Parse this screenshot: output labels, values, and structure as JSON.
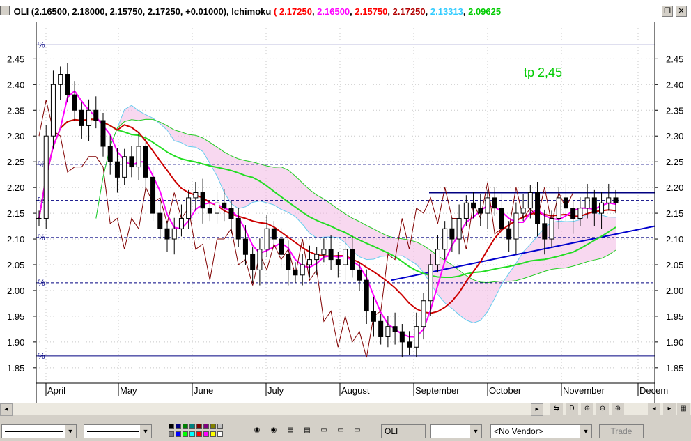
{
  "title_bar": {
    "symbol": "OLI",
    "ohlc_text": "(2.16500, 2.18000, 2.15750, 2.17250, +0.01000),",
    "indicator_name": "Ichimoku",
    "ichimoku_values": [
      {
        "text": "2.17250",
        "color": "#ff0000"
      },
      {
        "text": "2.16500",
        "color": "#ff00ff"
      },
      {
        "text": "2.15750",
        "color": "#ff0000"
      },
      {
        "text": "2.17250",
        "color": "#b00000"
      },
      {
        "text": "2.13313",
        "color": "#33ccff"
      },
      {
        "text": "2.09625",
        "color": "#00cc00"
      }
    ],
    "restore_icon": "restore-window-icon",
    "close_icon": "close-icon",
    "restore_glyph": "❐",
    "close_glyph": "✕"
  },
  "annotation": {
    "text": "tp 2,45",
    "color": "#00cc00"
  },
  "pct_marker": "%",
  "chart_data": {
    "type": "candlestick",
    "y_ticks": [
      "2.45",
      "2.40",
      "2.35",
      "2.30",
      "2.25",
      "2.20",
      "2.15",
      "2.10",
      "2.05",
      "2.00",
      "1.95",
      "1.90",
      "1.85"
    ],
    "ylim": [
      1.82,
      2.51
    ],
    "x_labels": [
      "April",
      "May",
      "June",
      "July",
      "August",
      "September",
      "October",
      "November",
      "Decem"
    ],
    "horizontal_levels": [
      {
        "value": 2.477,
        "style": "solid",
        "color": "#000080"
      },
      {
        "value": 2.245,
        "style": "dashed",
        "color": "#000080"
      },
      {
        "value": 2.175,
        "style": "dashed",
        "color": "#000080"
      },
      {
        "value": 2.103,
        "style": "dashed",
        "color": "#000080"
      },
      {
        "value": 2.015,
        "style": "dashed",
        "color": "#000080"
      },
      {
        "value": 1.873,
        "style": "solid",
        "color": "#000080"
      }
    ],
    "resistance_line": {
      "from_x": "September",
      "to_x": "November",
      "value": 2.19,
      "color": "#000080"
    },
    "trend_line": {
      "from_value": 2.02,
      "to_value": 2.12,
      "color": "#0000cc"
    },
    "series_colors": {
      "tenkan": "#ff00ff",
      "kijun": "#cc0000",
      "chikou": "#800000",
      "senkou_a": "#66ccee",
      "senkou_b": "#22cc22",
      "ma": "#22dd22",
      "candle": "#000000"
    },
    "close_approx": [
      2.14,
      2.3,
      2.4,
      2.42,
      2.38,
      2.35,
      2.32,
      2.35,
      2.33,
      2.28,
      2.25,
      2.22,
      2.26,
      2.24,
      2.28,
      2.22,
      2.15,
      2.12,
      2.1,
      2.12,
      2.14,
      2.18,
      2.19,
      2.16,
      2.15,
      2.17,
      2.16,
      2.14,
      2.1,
      2.07,
      2.04,
      2.08,
      2.12,
      2.1,
      2.07,
      2.04,
      2.03,
      2.05,
      2.06,
      2.07,
      2.08,
      2.06,
      2.05,
      2.08,
      2.04,
      2.02,
      1.96,
      1.94,
      1.91,
      1.93,
      1.92,
      1.9,
      1.89,
      1.93,
      1.98,
      2.05,
      2.08,
      2.12,
      2.1,
      2.14,
      2.17,
      2.16,
      2.15,
      2.18,
      2.16,
      2.12,
      2.1,
      2.15,
      2.16,
      2.19,
      2.13,
      2.1,
      2.14,
      2.18,
      2.16,
      2.14,
      2.16,
      2.18,
      2.15,
      2.17,
      2.18,
      2.17
    ]
  },
  "toolbar": {
    "symbol_field": "OLI",
    "vendor_select": "<No Vendor>",
    "trade_button": "Trade",
    "nav_icons": [
      "⇆",
      "D",
      "⊕",
      "⊖",
      "⊕",
      "◂",
      "▸",
      "▦"
    ],
    "palette": [
      "#000000",
      "#000080",
      "#008000",
      "#008080",
      "#800000",
      "#800080",
      "#808000",
      "#c0c0c0",
      "#808080",
      "#0000ff",
      "#00ff00",
      "#00ffff",
      "#ff0000",
      "#ff00ff",
      "#ffff00",
      "#ffffff"
    ]
  }
}
